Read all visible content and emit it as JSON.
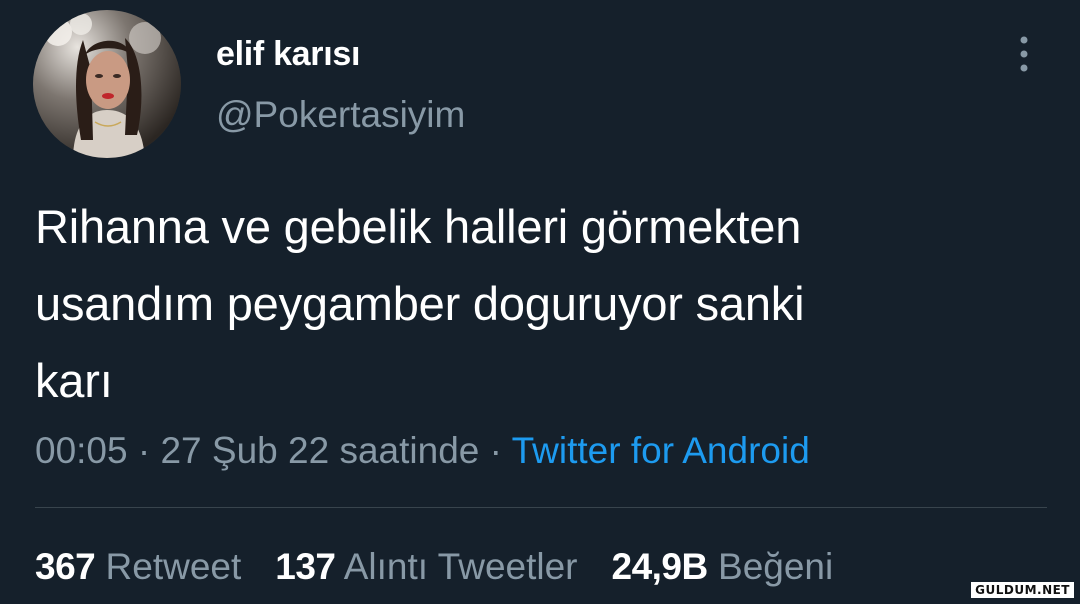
{
  "author": {
    "display_name": "elif karısı",
    "username": "@Pokertasiyim"
  },
  "tweet": {
    "lines": [
      "Rihanna ve gebelik halleri görmekten",
      "usandım peygamber doguruyor sanki",
      "karı"
    ],
    "time": "00:05",
    "separator": "·",
    "date": "27 Şub 22 saatinde",
    "source": "Twitter for Android"
  },
  "stats": {
    "retweets": {
      "count": "367",
      "label": "Retweet"
    },
    "quotes": {
      "count": "137",
      "label": "Alıntı Tweetler"
    },
    "likes": {
      "count": "24,9B",
      "label": "Beğeni"
    }
  },
  "watermark": "GULDUM.NET",
  "icons": {
    "more": "more-vertical-icon"
  },
  "colors": {
    "background": "#15202b",
    "secondary_text": "#8899a6",
    "link": "#1d9bf0",
    "divider": "#38444d"
  }
}
